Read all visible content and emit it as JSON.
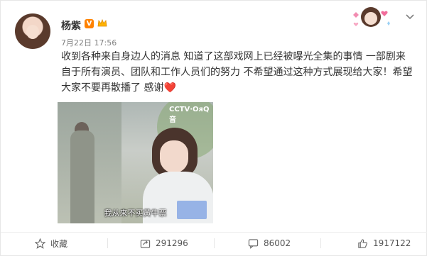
{
  "post": {
    "username": "杨紫",
    "verified_badge": "V",
    "date": "7月22日 17:56",
    "text": "收到各种来自身边人的消息 知道了这部戏网上已经被曝光全集的事情 一部剧来自于所有演员、团队和工作人员们的努力 不希望通过这种方式展现给大家！希望大家不要再散播了 感谢",
    "heart": "❤️",
    "media": {
      "watermark": "CCTV·OᴙQ音",
      "subtitle": "我从来不买黄牛票"
    }
  },
  "actions": {
    "favorite_label": "收藏",
    "share_count": "291296",
    "comment_count": "86002",
    "like_count": "1917122"
  },
  "colors": {
    "accent_orange": "#ff8200",
    "heart_red": "#e0245e",
    "meta_gray": "#808080"
  },
  "icons": [
    "avatar",
    "verified-icon",
    "crown-icon",
    "sticker-decoration",
    "chevron-down-icon",
    "star-icon",
    "share-icon",
    "comment-icon",
    "like-icon"
  ]
}
